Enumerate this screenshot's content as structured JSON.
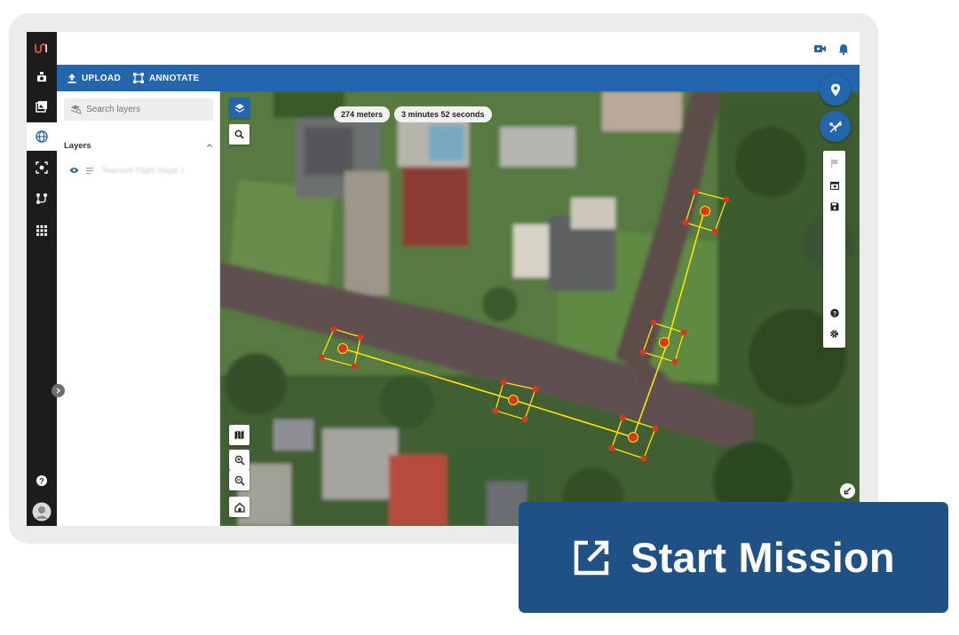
{
  "app": {
    "nav_items": [
      "logo",
      "live-camera",
      "gallery",
      "map",
      "detect",
      "pipeline",
      "apps"
    ],
    "active_nav": "map"
  },
  "toolbar": {
    "upload_label": "UPLOAD",
    "annotate_label": "ANNOTATE"
  },
  "layers_panel": {
    "search_placeholder": "Search layers",
    "title": "Layers",
    "layer_name": "Townsvill Flight Stage 1"
  },
  "mission": {
    "distance": "274 meters",
    "duration": "3 minutes 52 seconds"
  },
  "cta": {
    "label": "Start Mission"
  },
  "colors": {
    "brand": "#2366ae",
    "nav_bg": "#1c1c1c",
    "cta_bg": "#1f5186",
    "flight_path": "#ffe500",
    "waypoint": "#d8391e"
  }
}
